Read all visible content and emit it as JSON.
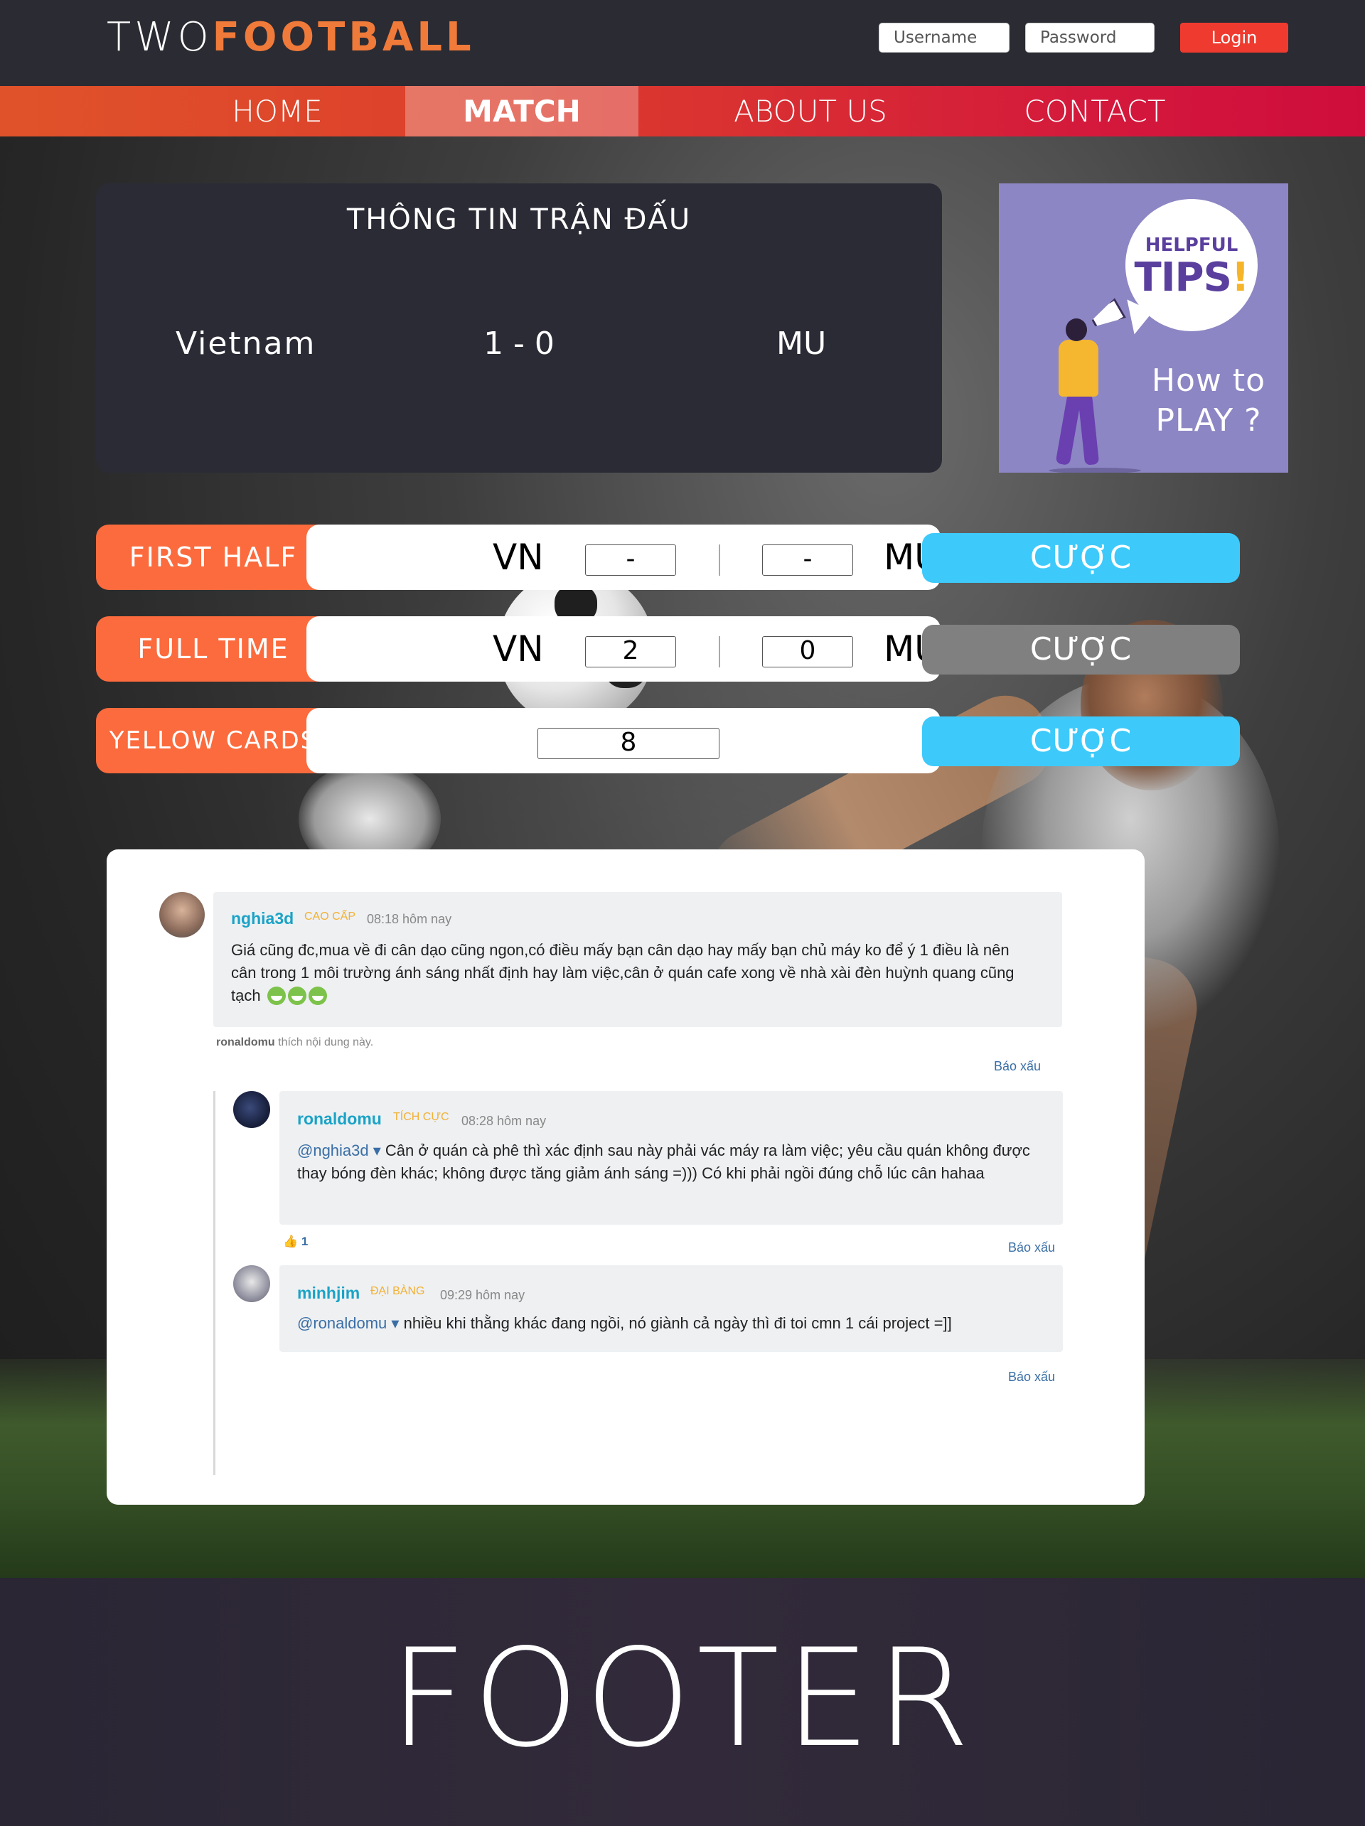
{
  "header": {
    "logo_part1": "TWO",
    "logo_part2": "FOOTBALL",
    "username_placeholder": "Username",
    "password_placeholder": "Password",
    "login_label": "Login"
  },
  "nav": {
    "items": [
      {
        "label": "HOME"
      },
      {
        "label": "MATCH"
      },
      {
        "label": "ABOUT US"
      },
      {
        "label": "CONTACT"
      }
    ],
    "active": "MATCH"
  },
  "match": {
    "title": "THÔNG TIN TRẬN ĐẤU",
    "team_a": "Vietnam",
    "score": "1 - 0",
    "team_b": "MU"
  },
  "tips": {
    "helpful": "HELPFUL",
    "tips": "TIPS",
    "excl": "!",
    "how_line1": "How to",
    "how_line2": "PLAY ?"
  },
  "bets": [
    {
      "label": "FIRST HALF",
      "team_a": "VN",
      "value_a": "-",
      "team_b": "MU",
      "value_b": "-",
      "button": "CƯỢC",
      "button_state": "active"
    },
    {
      "label": "FULL TIME",
      "team_a": "VN",
      "value_a": "2",
      "team_b": "MU",
      "value_b": "0",
      "button": "CƯỢC",
      "button_state": "disabled"
    },
    {
      "label": "YELLOW CARDS",
      "value": "8",
      "button": "CƯỢC",
      "button_state": "active"
    }
  ],
  "comments": {
    "main": {
      "user": "nghia3d",
      "rank": "CAO CẤP",
      "time": "08:18 hôm nay",
      "text": "Giá cũng đc,mua về đi cân dạo cũng ngon,có điều mấy bạn cân dạo hay mấy bạn chủ máy ko để ý 1 điều là nên cân trong 1 môi trường ánh sáng nhất định hay làm việc,cân ở quán cafe xong về nhà xài đèn huỳnh quang cũng tạch",
      "liked_user": "ronaldomu",
      "liked_text": "thích nội dung này.",
      "report": "Báo xấu"
    },
    "replies": [
      {
        "user": "ronaldomu",
        "rank": "TÍCH CỰC",
        "time": "08:28 hôm nay",
        "mention": "@nghia3d",
        "text": "Cân ở quán cà phê thì xác định sau này phải vác máy ra làm việc; yêu cầu quán không được thay bóng đèn khác; không được tăng giảm ánh sáng =))) Có khi phải ngồi đúng chỗ lúc cân hahaa",
        "likes": "1",
        "report": "Báo xấu"
      },
      {
        "user": "minhjim",
        "rank": "ĐẠI BÀNG",
        "time": "09:29 hôm nay",
        "mention": "@ronaldomu",
        "text": "nhiều khi thằng khác đang ngồi, nó giành cả ngày thì đi toi cmn 1 cái project =]]",
        "report": "Báo xấu"
      }
    ]
  },
  "footer": {
    "text": "FOOTER"
  },
  "colors": {
    "accent_orange": "#fb6b3d",
    "bet_blue": "#3dcafa",
    "bet_gray": "#808080",
    "login_red": "#ef3b2f",
    "username_teal": "#1ba3c6"
  }
}
